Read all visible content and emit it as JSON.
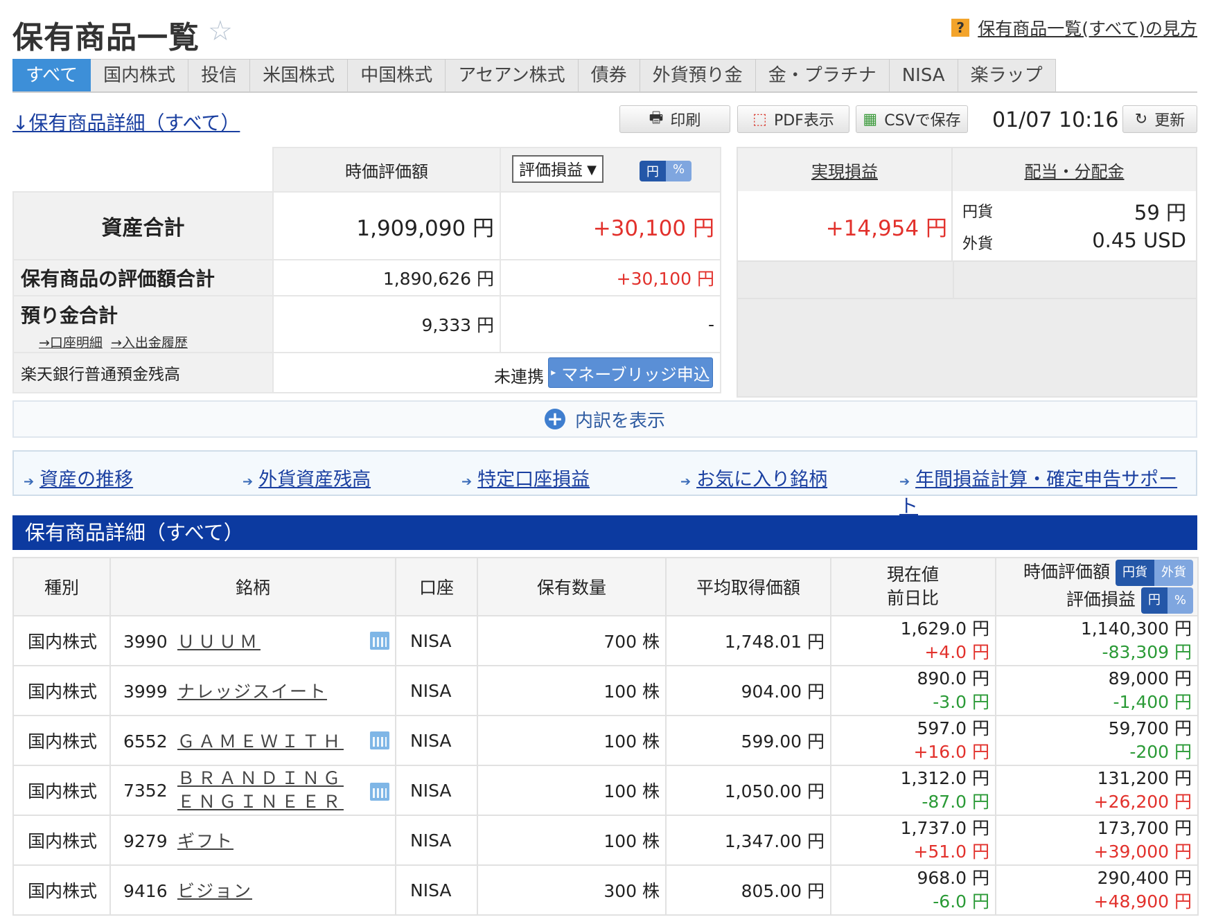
{
  "header": {
    "title": "保有商品一覧",
    "help_link": "保有商品一覧(すべて)の見方"
  },
  "tabs": [
    "すべて",
    "国内株式",
    "投信",
    "米国株式",
    "中国株式",
    "アセアン株式",
    "債券",
    "外貨預り金",
    "金・プラチナ",
    "NISA",
    "楽ラップ"
  ],
  "toolbar": {
    "detail_link": "↓保有商品詳細（すべて）",
    "print": "印刷",
    "pdf": "PDF表示",
    "csv": "CSVで保存",
    "timestamp": "01/07 10:16",
    "refresh": "更新"
  },
  "summary": {
    "col_value": "時価評価額",
    "col_select": "評価損益",
    "toggle_yen": "円",
    "toggle_pct": "%",
    "col_realized": "実現損益",
    "col_dividend": "配当・分配金",
    "total_label": "資産合計",
    "total_value": "1,909,090 円",
    "total_pl": "+30,100 円",
    "realized": "+14,954 円",
    "div_yen_label": "円貨",
    "div_yen_value": "59 円",
    "div_fx_label": "外貨",
    "div_fx_value": "0.45 USD",
    "holdings_label": "保有商品の評価額合計",
    "holdings_value": "1,890,626 円",
    "holdings_pl": "+30,100 円",
    "deposit_label": "預り金合計",
    "deposit_link1": "→口座明細",
    "deposit_link2": "→入出金履歴",
    "deposit_value": "9,333 円",
    "deposit_pl": "-",
    "bank_label": "楽天銀行普通預金残高",
    "bank_status": "未連携",
    "bank_button": "マネーブリッジ申込",
    "expand": "内訳を表示"
  },
  "links": [
    "資産の推移",
    "外貨資産残高",
    "特定口座損益",
    "お気に入り銘柄",
    "年間損益計算・確定申告サポート"
  ],
  "section_title": "保有商品詳細（すべて）",
  "table": {
    "headers": {
      "type": "種別",
      "name": "銘柄",
      "account": "口座",
      "qty": "保有数量",
      "avg": "平均取得価額",
      "price1": "現在値",
      "price2": "前日比",
      "value1": "時価評価額",
      "value2": "評価損益",
      "t1a": "円貨",
      "t1b": "外貨",
      "t2a": "円",
      "t2b": "%"
    },
    "rows": [
      {
        "type": "国内株式",
        "code": "3990",
        "name1": "ＵＵＵＭ",
        "name2": "",
        "account": "NISA",
        "qty": "700 株",
        "avg": "1,748.01 円",
        "price": "1,629.0 円",
        "change": "+4.0 円",
        "value": "1,140,300 円",
        "pl": "-83,309 円"
      },
      {
        "type": "国内株式",
        "code": "3999",
        "name1": "ナレッジスイート",
        "name2": "",
        "account": "NISA",
        "qty": "100 株",
        "avg": "904.00 円",
        "price": "890.0 円",
        "change": "-3.0 円",
        "value": "89,000 円",
        "pl": "-1,400 円"
      },
      {
        "type": "国内株式",
        "code": "6552",
        "name1": "ＧＡＭＥＷＩＴＨ",
        "name2": "",
        "account": "NISA",
        "qty": "100 株",
        "avg": "599.00 円",
        "price": "597.0 円",
        "change": "+16.0 円",
        "value": "59,700 円",
        "pl": "-200 円"
      },
      {
        "type": "国内株式",
        "code": "7352",
        "name1": "ＢＲＡＮＤＩＮＧ",
        "name2": "ＥＮＧＩＮＥＥＲ",
        "account": "NISA",
        "qty": "100 株",
        "avg": "1,050.00 円",
        "price": "1,312.0 円",
        "change": "-87.0 円",
        "value": "131,200 円",
        "pl": "+26,200 円"
      },
      {
        "type": "国内株式",
        "code": "9279",
        "name1": "ギフト",
        "name2": "",
        "account": "NISA",
        "qty": "100 株",
        "avg": "1,347.00 円",
        "price": "1,737.0 円",
        "change": "+51.0 円",
        "value": "173,700 円",
        "pl": "+39,000 円"
      },
      {
        "type": "国内株式",
        "code": "9416",
        "name1": "ビジョン",
        "name2": "",
        "account": "NISA",
        "qty": "300 株",
        "avg": "805.00 円",
        "price": "968.0 円",
        "change": "-6.0 円",
        "value": "290,400 円",
        "pl": "+48,900 円"
      }
    ]
  },
  "colors": {
    "accent": "#3d8fd8",
    "section": "#0c3aa0",
    "positive": "#e2312c",
    "negative": "#2a9a36"
  }
}
